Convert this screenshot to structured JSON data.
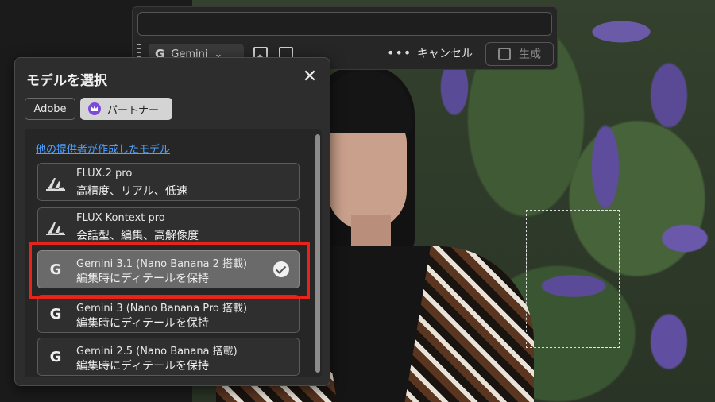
{
  "toolbar": {
    "prompt_value": "",
    "model_dropdown_label": "Gemini",
    "model_dropdown_glyph": "G",
    "more_label": "•••",
    "cancel_label": "キャンセル",
    "generate_label": "生成"
  },
  "dialog": {
    "title": "モデルを選択",
    "close_glyph": "✕",
    "tabs": [
      {
        "label": "Adobe"
      },
      {
        "label": "パートナー"
      }
    ],
    "section_link": "他の提供者が作成したモデル",
    "models": [
      {
        "name": "FLUX.2 pro",
        "desc": "高精度、リアル、低速",
        "icon": "flux-icon",
        "selected": false
      },
      {
        "name": "FLUX Kontext pro",
        "desc": "会話型、編集、高解像度",
        "icon": "flux-icon",
        "selected": false
      },
      {
        "name": "Gemini 3.1 (Nano Banana 2 搭載)",
        "desc": "編集時にディテールを保持",
        "icon": "google-icon",
        "glyph": "G",
        "selected": true
      },
      {
        "name": "Gemini 3 (Nano Banana Pro 搭載)",
        "desc": "編集時にディテールを保持",
        "icon": "google-icon",
        "glyph": "G",
        "selected": false
      },
      {
        "name": "Gemini 2.5 (Nano Banana 搭載)",
        "desc": "編集時にディテールを保持",
        "icon": "google-icon",
        "glyph": "G",
        "selected": false
      }
    ]
  },
  "colors": {
    "highlight": "#e8231a",
    "link": "#4ea0ff",
    "partner_crown": "#7b4ad8"
  }
}
